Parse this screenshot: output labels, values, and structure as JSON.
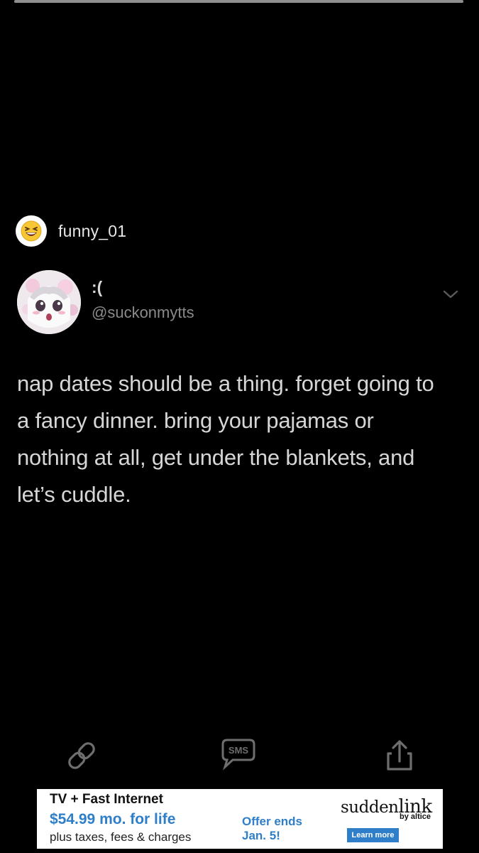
{
  "story": {
    "progress": 1.0,
    "username": "funny_01",
    "avatar_icon": "laughing-emoji-icon"
  },
  "tweet": {
    "display_name": ":(",
    "handle": "@suckonmytts",
    "avatar_icon": "anime-avatar-icon",
    "menu_icon": "chevron-down-icon",
    "text": "nap dates should be a thing. forget going to a fancy dinner. bring your pajamas or nothing at all, get under the blankets, and let’s cuddle."
  },
  "actions": {
    "link_icon": "link-icon",
    "sms_label": "SMS",
    "share_icon": "share-icon"
  },
  "ad": {
    "headline": "TV + Fast Internet",
    "price": "$54.99 mo. for life",
    "fineprint": "plus taxes, fees & charges",
    "offer": "Offer ends Jan. 5!",
    "brand_part1": "sudden",
    "brand_part2": "link",
    "byline": "by altice",
    "cta": "Learn more",
    "accent_color": "#2e7ec9"
  }
}
